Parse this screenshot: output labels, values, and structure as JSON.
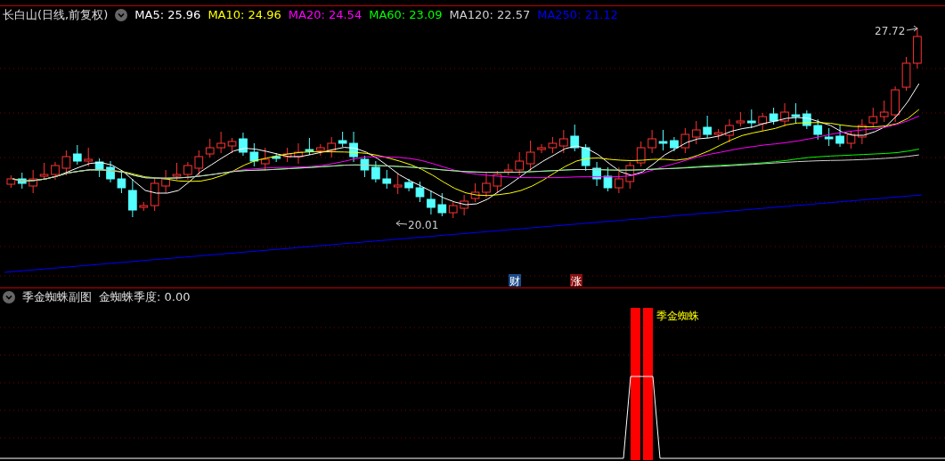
{
  "title": "长白山(日线,前复权)",
  "ma_legend": [
    {
      "label": "MA5: 25.96",
      "color": "#ffffff"
    },
    {
      "label": "MA10: 24.96",
      "color": "#ffff00"
    },
    {
      "label": "MA20: 24.54",
      "color": "#ff00ff"
    },
    {
      "label": "MA60: 23.09",
      "color": "#00ff00"
    },
    {
      "label": "MA120: 22.57",
      "color": "#d0d0d0"
    },
    {
      "label": "MA250: 21.12",
      "color": "#0000ff"
    }
  ],
  "high_marker": "27.72",
  "low_marker": "20.01",
  "event_badges": [
    {
      "label": "财",
      "color": "#1a4a8a"
    },
    {
      "label": "涨",
      "color": "#8a1010"
    }
  ],
  "sub_panel": {
    "title": "季金蜘蛛副图",
    "reading": "金蜘蛛季度: 0.00",
    "signal_label": "季金蜘蛛"
  }
}
